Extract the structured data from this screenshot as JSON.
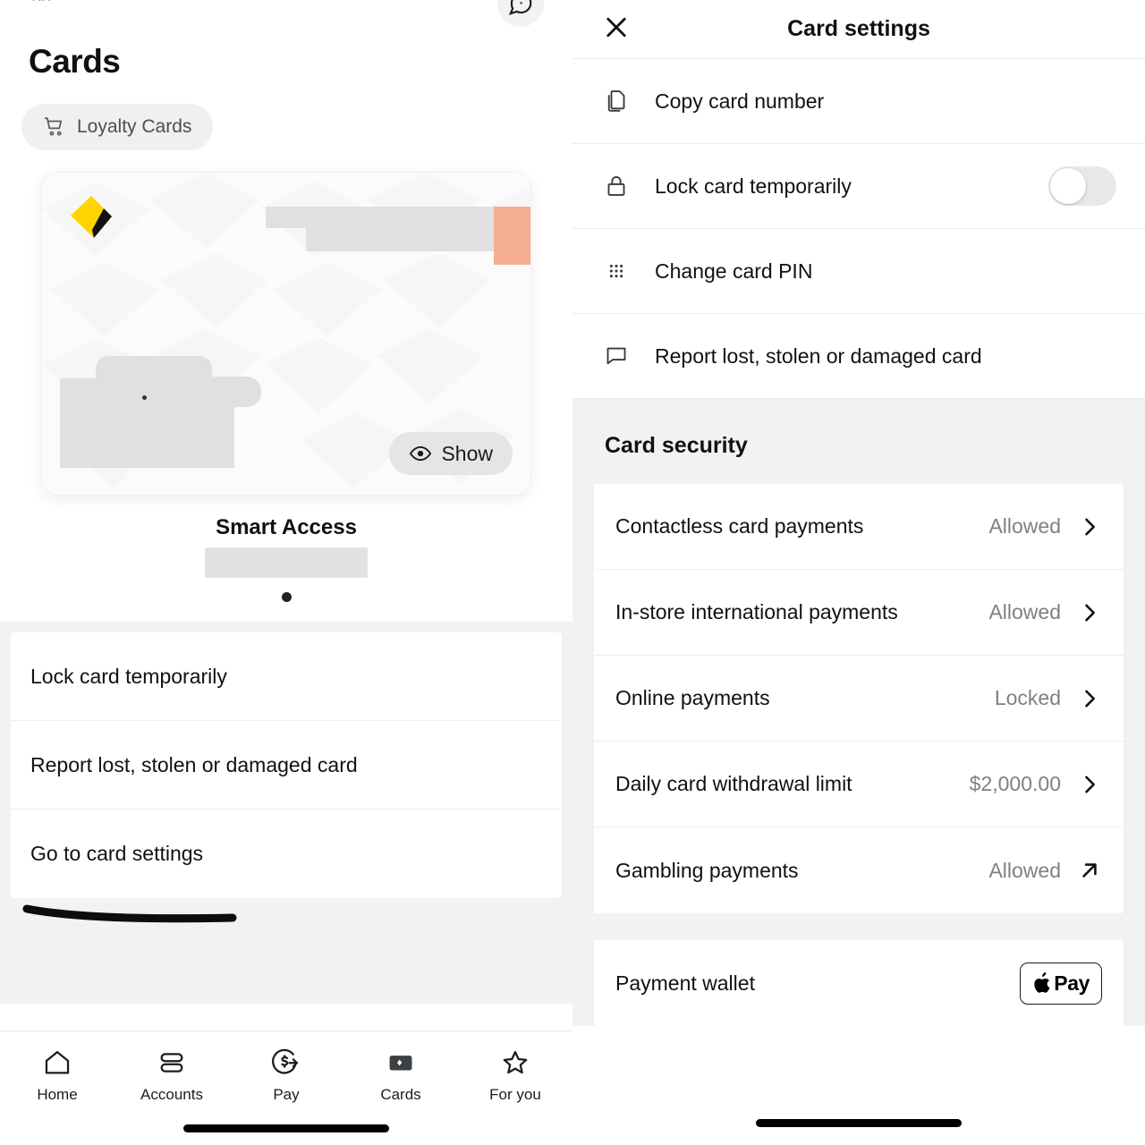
{
  "left": {
    "partial_name_text": "xn",
    "chat_icon": "chat-bubble-icon",
    "title": "Cards",
    "loyalty_chip": {
      "label": "Loyalty Cards",
      "icon": "shopping-cart-icon"
    },
    "card": {
      "brand_logo": "commbank-diamond-logo",
      "show_button": {
        "label": "Show",
        "icon": "eye-icon"
      },
      "name": "Smart Access",
      "redacted": true
    },
    "pager": {
      "current": 1,
      "total": 1
    },
    "actions": [
      "Lock card temporarily",
      "Report lost, stolen or damaged card",
      "Go to card settings"
    ],
    "bottom_nav": [
      {
        "label": "Home",
        "icon": "home-icon",
        "active": false
      },
      {
        "label": "Accounts",
        "icon": "accounts-icon",
        "active": false
      },
      {
        "label": "Pay",
        "icon": "pay-dollar-arrow-icon",
        "active": false
      },
      {
        "label": "Cards",
        "icon": "cards-icon",
        "active": true
      },
      {
        "label": "For you",
        "icon": "star-icon",
        "active": false
      }
    ]
  },
  "right": {
    "header": {
      "title": "Card settings",
      "close_icon": "close-x-icon"
    },
    "settings": [
      {
        "label": "Copy card number",
        "icon": "copy-icon",
        "control": "none"
      },
      {
        "label": "Lock card temporarily",
        "icon": "lock-icon",
        "control": "toggle",
        "toggle_on": false
      },
      {
        "label": "Change card PIN",
        "icon": "keypad-dots-icon",
        "control": "none"
      },
      {
        "label": "Report lost, stolen or damaged card",
        "icon": "speech-bubble-icon",
        "control": "none"
      }
    ],
    "security_section": {
      "title": "Card security",
      "rows": [
        {
          "label": "Contactless card payments",
          "value": "Allowed",
          "chevron": "chevron-right-icon"
        },
        {
          "label": "In-store international payments",
          "value": "Allowed",
          "chevron": "chevron-right-icon"
        },
        {
          "label": "Online payments",
          "value": "Locked",
          "chevron": "chevron-right-icon"
        },
        {
          "label": "Daily card withdrawal limit",
          "value": "$2,000.00",
          "chevron": "chevron-right-icon"
        },
        {
          "label": "Gambling payments",
          "value": "Allowed",
          "chevron": "external-link-arrow-icon"
        }
      ]
    },
    "wallet_row": {
      "label": "Payment wallet",
      "badge": "Pay",
      "badge_icon": "apple-logo-icon"
    }
  },
  "annotations": {
    "count": 3,
    "color": "#0d0d0d",
    "targets": [
      "Go to card settings",
      "Lock card temporarily",
      "Online payments"
    ]
  },
  "colors": {
    "brand_yellow": "#FFD400",
    "page_bg": "#FFFFFF",
    "section_bg": "#F2F2F2",
    "muted_text": "#808080",
    "redaction_gray": "#E0E0E0",
    "redaction_peach": "#F5AE92"
  }
}
